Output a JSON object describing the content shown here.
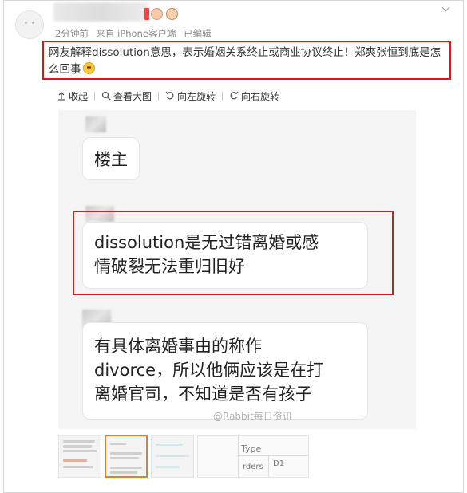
{
  "post": {
    "meta": {
      "time": "2分钟前",
      "source": "来自 iPhone客户端",
      "edited": "已编辑"
    },
    "text": "网友解释dissolution意思，表示婚姻关系终止或商业协议终止！郑爽张恒到底是怎么回事"
  },
  "toolbar": {
    "collapse": "收起",
    "view_large": "查看大图",
    "rotate_left": "向左旋转",
    "rotate_right": "向右旋转"
  },
  "image": {
    "bubble1": "楼主",
    "bubble2_line1": "dissolution是无过错离婚或感",
    "bubble2_line2": "情破裂无法重归旧好",
    "bubble3_line1": "有具体离婚事由的称作",
    "bubble3_line2": "divorce，所以他俩应该是在打",
    "bubble3_line3": "离婚官司，不知道是否有孩子",
    "watermark": "@Rabbit每日资讯"
  },
  "thumbnails": {
    "table_header": "Type",
    "table_cell_1": "rders",
    "table_cell_2": "D1"
  },
  "colors": {
    "highlight_red": "#d61818",
    "active_thumb": "#e97c24"
  }
}
